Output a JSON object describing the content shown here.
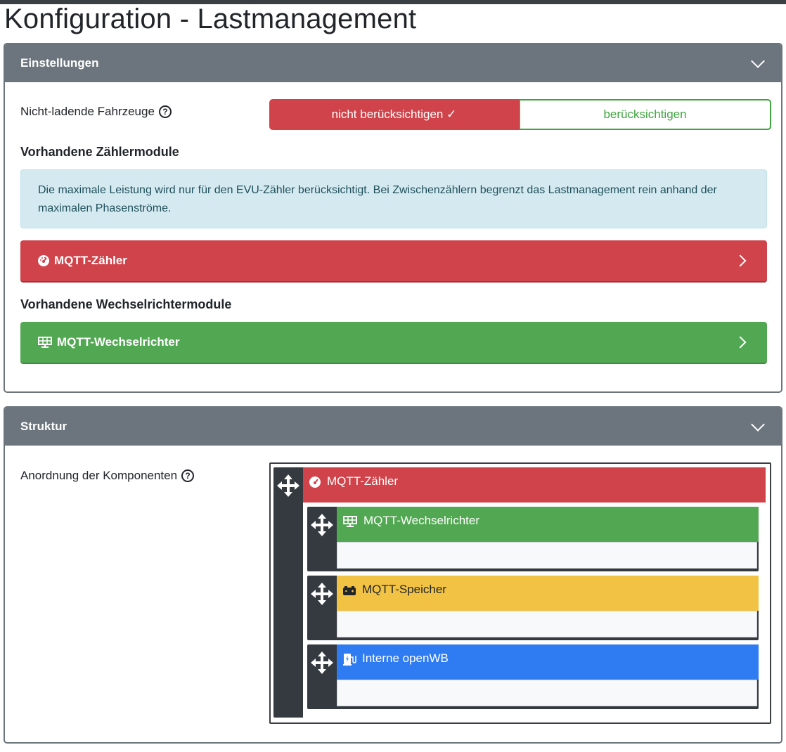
{
  "page": {
    "title": "Konfiguration - Lastmanagement"
  },
  "settings_card": {
    "header": "Einstellungen",
    "non_charging_label": "Nicht-ladende Fahrzeuge",
    "toggle": {
      "active_label": "nicht berücksichtigen ✓",
      "inactive_label": "berücksichtigen"
    },
    "meter_heading": "Vorhandene Zählermodule",
    "info_text": "Die maximale Leistung wird nur für den EVU-Zähler berücksichtigt. Bei Zwischenzählern begrenzt das Lastmanagement rein anhand der maximalen Phasenströme.",
    "meter_module": {
      "label": "MQTT-Zähler",
      "icon": "gauge-icon"
    },
    "inverter_heading": "Vorhandene Wechselrichtermodule",
    "inverter_module": {
      "label": "MQTT-Wechselrichter",
      "icon": "solar-panel-icon"
    }
  },
  "structure_card": {
    "header": "Struktur",
    "arrangement_label": "Anordnung der Komponenten",
    "tree": {
      "root": {
        "label": "MQTT-Zähler",
        "icon": "gauge-icon",
        "color": "#d0434a"
      },
      "children": [
        {
          "label": "MQTT-Wechselrichter",
          "icon": "solar-panel-icon",
          "color": "#52a852"
        },
        {
          "label": "MQTT-Speicher",
          "icon": "battery-icon",
          "color": "#f2c244"
        },
        {
          "label": "Interne openWB",
          "icon": "charging-station-icon",
          "color": "#2f7bf1"
        }
      ]
    }
  },
  "colors": {
    "danger": "#d0434a",
    "success": "#52a852",
    "warning": "#f2c244",
    "primary": "#2f7bf1",
    "secondary": "#6c757d",
    "info_bg": "#d5eaf0"
  }
}
